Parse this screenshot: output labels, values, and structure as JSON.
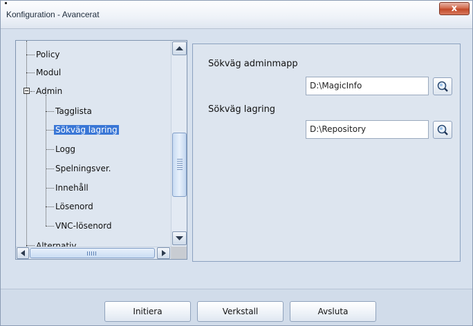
{
  "window": {
    "title": "Konfiguration - Avancerat",
    "close_label": "x"
  },
  "tree": {
    "items": [
      {
        "label": "Policy",
        "level": 1
      },
      {
        "label": "Modul",
        "level": 1
      },
      {
        "label": "Admin",
        "level": 1,
        "expanded": true
      },
      {
        "label": "Tagglista",
        "level": 2
      },
      {
        "label": "Sökväg lagring",
        "level": 2,
        "selected": true
      },
      {
        "label": "Logg",
        "level": 2
      },
      {
        "label": "Spelningsver.",
        "level": 2
      },
      {
        "label": "Innehåll",
        "level": 2
      },
      {
        "label": "Lösenord",
        "level": 2
      },
      {
        "label": "VNC-lösenord",
        "level": 2
      },
      {
        "label": "Alternativ",
        "level": 1,
        "clipped": true
      }
    ]
  },
  "settings": {
    "admin_folder_label": "Sökväg adminmapp",
    "admin_folder_value": "D:\\MagicInfo",
    "storage_label": "Sökväg lagring",
    "storage_value": "D:\\Repository",
    "browse_icon": "magnifier-icon"
  },
  "footer": {
    "initiate_label": "Initiera",
    "apply_label": "Verkstall",
    "exit_label": "Avsluta"
  },
  "colors": {
    "selection": "#3a77d6",
    "window_bg": "#d7e1ee",
    "close_button": "#c24a2a"
  }
}
